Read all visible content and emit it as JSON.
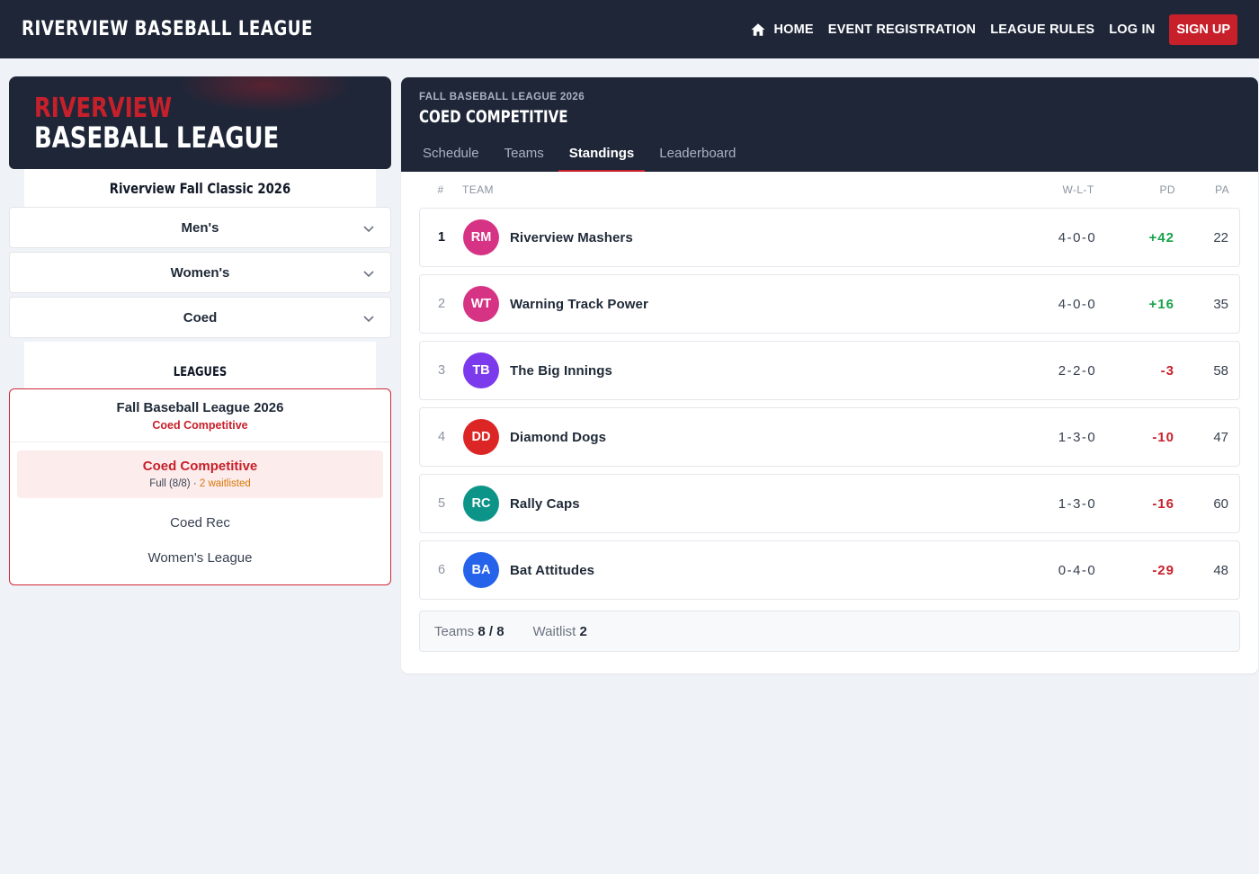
{
  "nav": {
    "brand": "RIVERVIEW BASEBALL LEAGUE",
    "home": "HOME",
    "event_registration": "EVENT REGISTRATION",
    "league_rules": "LEAGUE RULES",
    "log_in": "LOG IN",
    "sign_up": "SIGN UP"
  },
  "sidebar": {
    "hero_line1": "RIVERVIEW",
    "hero_line2": "BASEBALL LEAGUE",
    "event_title": "Riverview Fall Classic 2026",
    "divisions": [
      "Men's",
      "Women's",
      "Coed"
    ],
    "leagues_heading": "LEAGUES",
    "league_box": {
      "title": "Fall Baseball League 2026",
      "subtitle": "Coed Competitive",
      "active": {
        "title": "Coed Competitive",
        "status": "Full (8/8)",
        "separator": " · ",
        "waitlist": "2 waitlisted"
      },
      "items": [
        "Coed Rec",
        "Women's League"
      ]
    }
  },
  "panel": {
    "kicker": "FALL BASEBALL LEAGUE 2026",
    "title": "COED COMPETITIVE",
    "tabs": [
      "Schedule",
      "Teams",
      "Standings",
      "Leaderboard"
    ],
    "active_tab": "Standings",
    "columns": {
      "rank": "#",
      "team": "TEAM",
      "wlt": "W-L-T",
      "pd": "PD",
      "pa": "PA"
    },
    "standings": [
      {
        "rank": "1",
        "initials": "RM",
        "name": "Riverview Mashers",
        "wlt": "4-0-0",
        "pd": "+42",
        "pa": "22",
        "color": "#d63384"
      },
      {
        "rank": "2",
        "initials": "WT",
        "name": "Warning Track Power",
        "wlt": "4-0-0",
        "pd": "+16",
        "pa": "35",
        "color": "#d63384"
      },
      {
        "rank": "3",
        "initials": "TB",
        "name": "The Big Innings",
        "wlt": "2-2-0",
        "pd": "-3",
        "pa": "58",
        "color": "#7c3aed"
      },
      {
        "rank": "4",
        "initials": "DD",
        "name": "Diamond Dogs",
        "wlt": "1-3-0",
        "pd": "-10",
        "pa": "47",
        "color": "#dc2626"
      },
      {
        "rank": "5",
        "initials": "RC",
        "name": "Rally Caps",
        "wlt": "1-3-0",
        "pd": "-16",
        "pa": "60",
        "color": "#0d9488"
      },
      {
        "rank": "6",
        "initials": "BA",
        "name": "Bat Attitudes",
        "wlt": "0-4-0",
        "pd": "-29",
        "pa": "48",
        "color": "#2563eb"
      }
    ],
    "footer": {
      "teams_label": "Teams",
      "teams_value": "8 / 8",
      "waitlist_label": "Waitlist",
      "waitlist_value": "2"
    }
  },
  "colors": {
    "navy": "#1e2638",
    "accent_red": "#c8202b",
    "positive": "#16a34a",
    "waitlist": "#d97706"
  },
  "icons": {
    "home": "home-icon",
    "chevron": "chevron-down-icon"
  }
}
